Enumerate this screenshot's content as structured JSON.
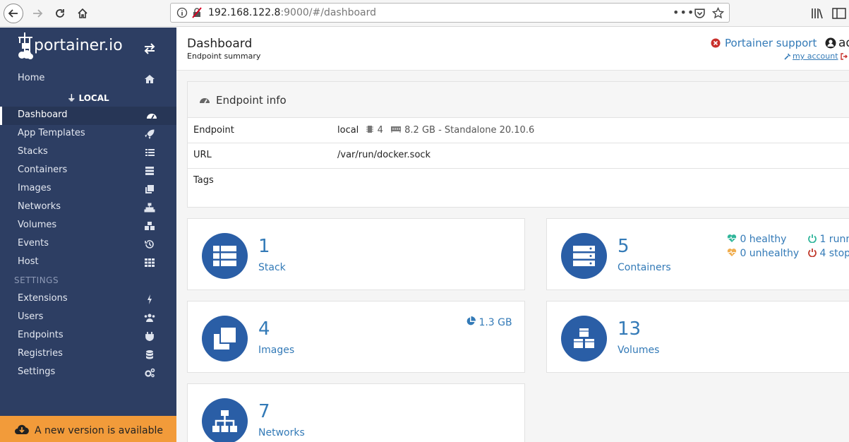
{
  "browser": {
    "url_host": "192.168.122.8",
    "url_rest": ":9000/#/dashboard"
  },
  "sidebar": {
    "logo": "portainer.io",
    "home": "Home",
    "endpoint": "LOCAL",
    "items": [
      {
        "label": "Dashboard",
        "icon": "dashboard-icon"
      },
      {
        "label": "App Templates",
        "icon": "rocket-icon"
      },
      {
        "label": "Stacks",
        "icon": "list-icon"
      },
      {
        "label": "Containers",
        "icon": "server-icon"
      },
      {
        "label": "Images",
        "icon": "clone-icon"
      },
      {
        "label": "Networks",
        "icon": "sitemap-icon"
      },
      {
        "label": "Volumes",
        "icon": "cubes-icon"
      },
      {
        "label": "Events",
        "icon": "history-icon"
      },
      {
        "label": "Host",
        "icon": "th-icon"
      }
    ],
    "settings_heading": "SETTINGS",
    "settings_items": [
      {
        "label": "Extensions",
        "icon": "bolt-icon"
      },
      {
        "label": "Users",
        "icon": "users-icon"
      },
      {
        "label": "Endpoints",
        "icon": "plug-icon"
      },
      {
        "label": "Registries",
        "icon": "database-icon"
      },
      {
        "label": "Settings",
        "icon": "cogs-icon"
      }
    ],
    "update_text": "A new version is available"
  },
  "header": {
    "title": "Dashboard",
    "subtitle": "Endpoint summary",
    "support": "Portainer support",
    "account": "my account",
    "user": "ad"
  },
  "endpoint_info": {
    "title": "Endpoint info",
    "rows": [
      {
        "key": "Endpoint",
        "name": "local",
        "cpus": "4",
        "memory": "8.2 GB - Standalone 20.10.6"
      },
      {
        "key": "URL",
        "value": "/var/run/docker.sock"
      },
      {
        "key": "Tags",
        "value": ""
      }
    ]
  },
  "tiles": {
    "stack": {
      "count": "1",
      "label": "Stack"
    },
    "containers": {
      "count": "5",
      "label": "Containers",
      "healthy": "0 healthy",
      "unhealthy": "0 unhealthy",
      "running": "1 runn",
      "stopped": "4 stop"
    },
    "images": {
      "count": "4",
      "label": "Images",
      "size": "1.3 GB"
    },
    "volumes": {
      "count": "13",
      "label": "Volumes"
    },
    "networks": {
      "count": "7",
      "label": "Networks"
    }
  },
  "colors": {
    "sidebar_bg": "#2d3e63",
    "accent": "#337ab7",
    "tile_circle": "#2a5ea6",
    "update_bar": "#f29b3a",
    "healthy": "#2fb59a",
    "unhealthy": "#f0ad4e",
    "stopped": "#c0392b"
  }
}
